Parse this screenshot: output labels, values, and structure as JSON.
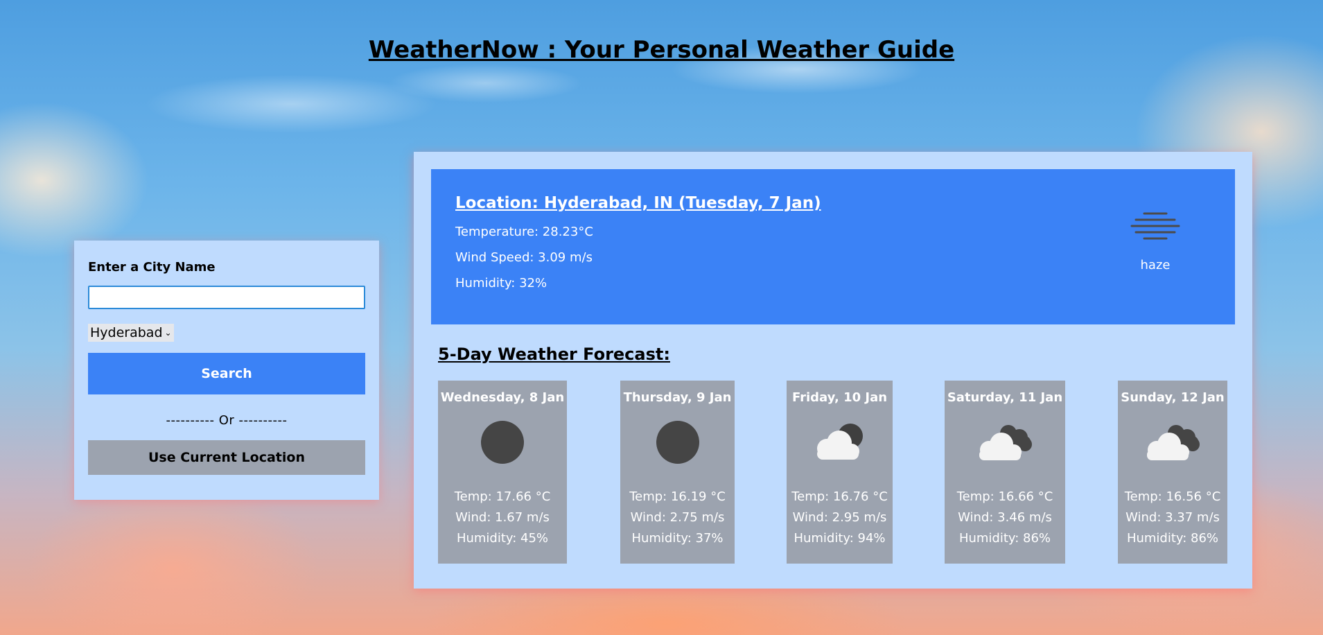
{
  "header": {
    "title": "WeatherNow : Your Personal Weather Guide"
  },
  "search": {
    "label": "Enter a City Name",
    "input_value": "",
    "placeholder": "",
    "selected_city": "Hyderabad",
    "search_label": "Search",
    "or_text": "---------- Or ----------",
    "location_label": "Use Current Location"
  },
  "current": {
    "location": "Location: Hyderabad, IN (Tuesday, 7 Jan)",
    "temperature": "Temperature: 28.23°C",
    "wind": "Wind Speed: 3.09 m/s",
    "humidity": "Humidity: 32%",
    "icon": "haze-icon",
    "description": "haze"
  },
  "forecast": {
    "title": "5-Day Weather Forecast:",
    "days": [
      {
        "date": "Wednesday, 8 Jan",
        "icon": "moon-icon",
        "temp": "Temp: 17.66 °C",
        "wind": "Wind: 1.67 m/s",
        "humidity": "Humidity: 45%"
      },
      {
        "date": "Thursday, 9 Jan",
        "icon": "moon-icon",
        "temp": "Temp: 16.19 °C",
        "wind": "Wind: 2.75 m/s",
        "humidity": "Humidity: 37%"
      },
      {
        "date": "Friday, 10 Jan",
        "icon": "partly-cloudy-night-icon",
        "temp": "Temp: 16.76 °C",
        "wind": "Wind: 2.95 m/s",
        "humidity": "Humidity: 94%"
      },
      {
        "date": "Saturday, 11 Jan",
        "icon": "broken-clouds-icon",
        "temp": "Temp: 16.66 °C",
        "wind": "Wind: 3.46 m/s",
        "humidity": "Humidity: 86%"
      },
      {
        "date": "Sunday, 12 Jan",
        "icon": "broken-clouds-icon",
        "temp": "Temp: 16.56 °C",
        "wind": "Wind: 3.37 m/s",
        "humidity": "Humidity: 86%"
      }
    ]
  },
  "colors": {
    "accent": "#3b82f6",
    "panel": "#bfdbfe",
    "card": "#9ca3af"
  }
}
